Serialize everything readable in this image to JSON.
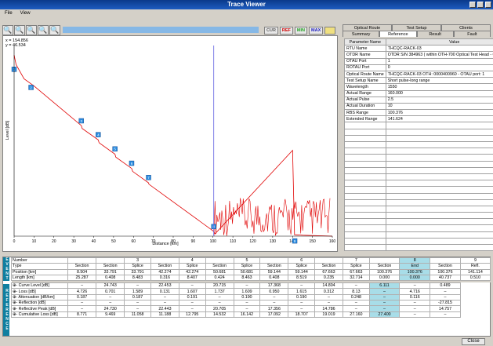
{
  "window": {
    "title": "Trace Viewer"
  },
  "menu": {
    "file": "File",
    "view": "View"
  },
  "modes": [
    "CUR",
    "REF",
    "MIN",
    "MAX",
    ""
  ],
  "plot": {
    "readout_x": "x = 154.856",
    "readout_y": "y = 46.534",
    "xlabel": "Distance [km]",
    "ylabel": "Level [dB]"
  },
  "chart_data": {
    "type": "line",
    "title": "",
    "xlabel": "Distance [km]",
    "ylabel": "Level [dB]",
    "xlim": [
      0,
      160
    ],
    "ylim": [
      0,
      40
    ],
    "x_ticks": [
      "0",
      "10",
      "20",
      "30",
      "40",
      "50",
      "60",
      "70",
      "80",
      "90",
      "100",
      "110",
      "120",
      "130",
      "140",
      "150",
      "160"
    ],
    "trace": {
      "x": [
        0,
        1,
        5,
        10,
        33.8,
        34.2,
        42.3,
        42.7,
        50.7,
        51.1,
        59.1,
        59.6,
        67.6,
        67.8,
        100.376,
        101,
        140,
        141,
        145,
        160
      ],
      "y": [
        38,
        36,
        33,
        31.5,
        23.2,
        22.6,
        20.2,
        19.6,
        17.2,
        16.6,
        14.2,
        13.6,
        11.2,
        10.9,
        1,
        0.5,
        18,
        0.3,
        0.2,
        0
      ]
    },
    "markers": [
      {
        "label": "1",
        "x": 0,
        "y": 35
      },
      {
        "label": "2",
        "x": 8.5,
        "y": 31.2
      },
      {
        "label": "3",
        "x": 33.8,
        "y": 24.2
      },
      {
        "label": "4",
        "x": 42.3,
        "y": 21.3
      },
      {
        "label": "5",
        "x": 50.7,
        "y": 18.3
      },
      {
        "label": "6",
        "x": 59.1,
        "y": 15.3
      },
      {
        "label": "7",
        "x": 67.6,
        "y": 12.3
      },
      {
        "label": "8",
        "x": 100.376,
        "y": 2
      },
      {
        "label": "9",
        "x": 141.1,
        "y": -1
      }
    ],
    "cursor_x": 100.376,
    "series": [
      {
        "color": "#e00000"
      }
    ]
  },
  "tabs_top": [
    "Optical Route",
    "Test Setup",
    "Clients"
  ],
  "tabs_bottom": [
    "Summary",
    "Reference",
    "Result",
    "Fault"
  ],
  "params": {
    "headers": [
      "Parameter Name",
      "Value",
      "Unit"
    ],
    "rows": [
      [
        "RTU Name",
        "THCQC-RACK-03",
        ""
      ],
      [
        "OTDR Name",
        "OTDR S/N 384963 ( within OTH-700 Optical Test Head - OTH_THCQC )",
        ""
      ],
      [
        "OTAU Port",
        "1",
        ""
      ],
      [
        "ROTAU Port",
        "0",
        ""
      ],
      [
        "Optical Route Name",
        "THCQC-RACK-03 OTH: 0000400960 - OTAU port: 1",
        ""
      ],
      [
        "Test Setup Name",
        "Short pulse-long range",
        ""
      ],
      [
        "Wavelength",
        "1550",
        "nm"
      ],
      [
        "Actual Range",
        "160.000",
        "km"
      ],
      [
        "Actual Pulse",
        "2.5",
        "us"
      ],
      [
        "Actual Duration",
        "10",
        "s"
      ],
      [
        "RBS Range",
        "100.376",
        "km"
      ],
      [
        "Extended Range",
        "141.624",
        "km"
      ],
      [
        "",
        "",
        ""
      ],
      [
        "",
        "",
        ""
      ],
      [
        "",
        "",
        ""
      ],
      [
        "",
        "",
        ""
      ],
      [
        "",
        "",
        ""
      ],
      [
        "",
        "",
        ""
      ],
      [
        "",
        "",
        ""
      ],
      [
        "",
        "",
        ""
      ],
      [
        "",
        "",
        ""
      ],
      [
        "",
        "",
        ""
      ],
      [
        "",
        "",
        ""
      ],
      [
        "",
        "",
        ""
      ],
      [
        "",
        "",
        ""
      ],
      [
        "",
        "",
        ""
      ],
      [
        "",
        "",
        ""
      ],
      [
        "",
        "",
        ""
      ],
      [
        "",
        "",
        ""
      ],
      [
        "",
        "",
        ""
      ],
      [
        "",
        "",
        ""
      ],
      [
        "",
        "",
        ""
      ]
    ]
  },
  "events_tag": "EVENTS",
  "reference_tag": "REFERENCE",
  "events": {
    "rows": [
      [
        "Number",
        "",
        "",
        "3",
        "",
        "4",
        "",
        "5",
        "",
        "6",
        "",
        "7",
        "",
        "8",
        "",
        "9"
      ],
      [
        "Type",
        "Section",
        "Section",
        "Splice",
        "Section",
        "Splice",
        "Section",
        "Splice",
        "Section",
        "Splice",
        "Section",
        "Splice",
        "Section",
        "End",
        "Section",
        "Refl."
      ],
      [
        "Position [km]",
        "8.504",
        "33.791",
        "33.791",
        "42.274",
        "42.274",
        "50.681",
        "50.681",
        "59.144",
        "59.144",
        "67.663",
        "67.663",
        "100.376",
        "100.376",
        "100.376",
        "141.114"
      ],
      [
        "Length [km]",
        "25.287",
        "0.408",
        "8.483",
        "0.316",
        "8.407",
        "0.424",
        "8.463",
        "0.408",
        "8.519",
        "0.235",
        "32.714",
        "0.000",
        "0.000",
        "40.737",
        "0.510"
      ]
    ]
  },
  "reference": {
    "rows": [
      [
        "⊕- Curve Level [dB]",
        "–",
        "24.743",
        "–",
        "22.453",
        "–",
        "20.715",
        "–",
        "17.368",
        "–",
        "14.804",
        "–",
        "6.111",
        "–",
        "0.489"
      ],
      [
        "⊕- Loss [dB]",
        "4.726",
        "0.701",
        "1.589",
        "0.131",
        "1.607",
        "1.737",
        "1.609",
        "0.950",
        "1.615",
        "0.312",
        "8.13",
        "–",
        "4.716",
        "–"
      ],
      [
        "⊕- Attenuation [dB/km]",
        "0.187",
        "–",
        "0.187",
        "–",
        "0.191",
        "–",
        "0.190",
        "–",
        "0.190",
        "–",
        "0.248",
        "–",
        "0.116",
        "–"
      ],
      [
        "⊕- Reflection [dB]",
        "–",
        "–",
        "–",
        "–",
        "–",
        "–",
        "–",
        "–",
        "–",
        "–",
        "–",
        "–",
        "–",
        "-27.815"
      ],
      [
        "⊕- Reflective Peak [dB]",
        "–",
        "24.730",
        "–",
        "22.443",
        "–",
        "20.705",
        "–",
        "17.356",
        "–",
        "14.786",
        "–",
        "–",
        "–",
        "14.757"
      ],
      [
        "⊕- Cumulative Loss [dB]",
        "8.771",
        "9.469",
        "11.058",
        "11.188",
        "12.795",
        "14.532",
        "16.142",
        "17.092",
        "18.707",
        "19.019",
        "27.160",
        "27.400",
        "–",
        "–"
      ]
    ]
  },
  "close_label": "Close"
}
